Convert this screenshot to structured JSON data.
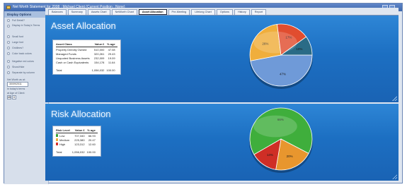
{
  "window": {
    "title": "Net Worth Statement for 2008 : Michael Client (Current Position : None)"
  },
  "sidebar": {
    "header": "Display Options",
    "options": [
      {
        "label": "Full Detail?",
        "two_line": false
      },
      {
        "label": "Display in Today's Terms",
        "two_line": true
      },
      {
        "label": "Small font",
        "two_line": false
      },
      {
        "label": "Large font",
        "two_line": false
      },
      {
        "label": "Gridlines?",
        "two_line": false
      },
      {
        "label": "Color back colors",
        "two_line": false
      },
      {
        "label": "Negative red colors",
        "two_line": false
      },
      {
        "label": "Show/Hide",
        "two_line": false
      },
      {
        "label": "Separate by column",
        "two_line": false
      }
    ],
    "date_label": "Net Worth as at:",
    "date_value": "30/09/2011",
    "todays_terms_label": "In today's terms",
    "age_label": "at Age of Client:",
    "age_value": "45"
  },
  "tabs": [
    {
      "label": "Balances",
      "active": false
    },
    {
      "label": "Summary",
      "active": false
    },
    {
      "label": "Assets Chart",
      "active": false
    },
    {
      "label": "NetWorth Chart",
      "active": false
    },
    {
      "label": "Asset Allocation",
      "active": true
    },
    {
      "label": "Pre-Meeting",
      "active": false
    },
    {
      "label": "Lifelong Chart",
      "active": false
    },
    {
      "label": "Options",
      "active": false
    },
    {
      "label": "History",
      "active": false
    },
    {
      "label": "Report",
      "active": false
    }
  ],
  "asset_allocation": {
    "title": "Asset Allocation",
    "columns": [
      "Asset Class",
      "Value £",
      "% age"
    ],
    "rows": [
      {
        "label": "Property Directly Owned",
        "value": "510,000",
        "pct": "47.08"
      },
      {
        "label": "Managed Funds",
        "value": "320,261",
        "pct": "29.43"
      },
      {
        "label": "Unquoted Business Assets",
        "value": "232,009",
        "pct": "19.09"
      },
      {
        "label": "Cash or Cash Equivalents",
        "value": "154,178",
        "pct": "11.64"
      }
    ],
    "total": {
      "label": "Total",
      "value": "1,056,032",
      "pct": "100.00"
    },
    "slices": [
      {
        "value": 47,
        "label": "47%",
        "color": "#6f9ad8"
      },
      {
        "value": 26,
        "label": "26%",
        "color": "#f0ae3c"
      },
      {
        "value": 17,
        "label": "17%",
        "color": "#e14d2f"
      },
      {
        "value": 10,
        "label": "10%",
        "color": "#2a6b86"
      }
    ]
  },
  "risk_allocation": {
    "title": "Risk Allocation",
    "columns": [
      "Risk Level",
      "Value £",
      "% age"
    ],
    "rows": [
      {
        "label": "Low",
        "value": "707,340",
        "pct": "66.93",
        "color": "#39a33a"
      },
      {
        "label": "Medium",
        "value": "225,380",
        "pct": "20.47",
        "color": "#f0ae3c"
      },
      {
        "label": "High",
        "value": "123,312",
        "pct": "12.60",
        "color": "#d6332c"
      }
    ],
    "total": {
      "label": "Total",
      "value": "1,056,032",
      "pct": "100.00"
    },
    "slices": [
      {
        "value": 66,
        "label": "66%",
        "color": "#3fae3c"
      },
      {
        "value": 20,
        "label": "20%",
        "color": "#e8962e"
      },
      {
        "value": 14,
        "label": "14%",
        "color": "#cf2e26"
      }
    ]
  }
}
